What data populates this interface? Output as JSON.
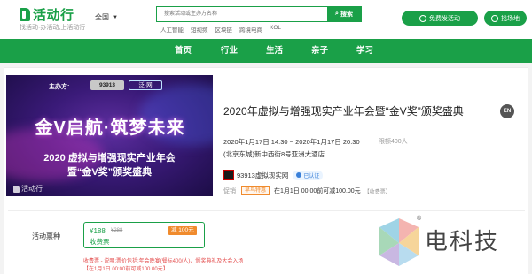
{
  "header": {
    "logo_text": "活动行",
    "tagline": "找活动·办活动,上活动行",
    "city": "全国",
    "search_placeholder": "搜索活动或主办方名称",
    "search_button": "搜索",
    "hot_tags": [
      "人工智能",
      "短视频",
      "区块链",
      "跨境电商",
      "KOL"
    ],
    "publish_button": "免费发活动",
    "venue_button": "找场地",
    "brand_color": "#1aa048"
  },
  "nav": {
    "items": [
      "首页",
      "行业",
      "生活",
      "亲子",
      "学习"
    ]
  },
  "banner": {
    "host_label": "主办方:",
    "host_logo_1": "93913",
    "host_logo_2": "泛·网",
    "headline": "金V启航·筑梦未来",
    "subtitle_line1": "2020 虚拟与增强现实产业年会",
    "subtitle_line2": "暨“金V奖”颁奖盛典",
    "watermark": "活动行"
  },
  "event": {
    "title": "2020年虚拟与增强现实产业年会暨“金V奖”颁奖盛典",
    "lang_badge": "EN",
    "time": "2020年1月17日 14:30 ~ 2020年1月17日 20:30",
    "limit": "限额400人",
    "address": "(北京东城)新中西街8号亚洲大酒店",
    "organizer": "93913虚拟现实网",
    "verified_label": "已认证",
    "promo_label": "促销",
    "promo_tag": "早鸟特惠",
    "promo_text": "在1月1日 00:00前可减100.00元",
    "promo_more": "【收费票】"
  },
  "tickets": {
    "section_label": "活动票种",
    "items": [
      {
        "price": "¥188",
        "original_price": "¥288",
        "name": "收费票",
        "discount": "减 100元"
      }
    ],
    "note_line1": "收费票 - 说明:票价包括:年会晚宴(餐标400/人)、颁奖典礼及大会入场",
    "note_line2": "【在1月1日 00:00前可减100.00元】"
  },
  "watermark": {
    "brand": "电科技",
    "registered": "®"
  }
}
